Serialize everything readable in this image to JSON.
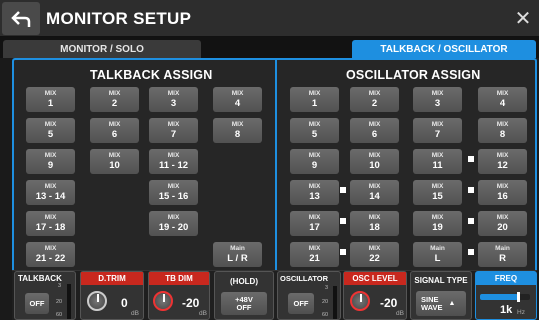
{
  "header": {
    "title": "MONITOR SETUP"
  },
  "tabs": {
    "left": "MONITOR / SOLO",
    "right": "TALKBACK / OSCILLATOR"
  },
  "talkback_assign": {
    "title": "TALKBACK ASSIGN",
    "buttons": [
      {
        "l1": "MIX",
        "l2": "1"
      },
      {
        "l1": "MIX",
        "l2": "2"
      },
      {
        "l1": "MIX",
        "l2": "3"
      },
      {
        "l1": "MIX",
        "l2": "4"
      },
      {
        "l1": "MIX",
        "l2": "5"
      },
      {
        "l1": "MIX",
        "l2": "6"
      },
      {
        "l1": "MIX",
        "l2": "7"
      },
      {
        "l1": "MIX",
        "l2": "8"
      },
      {
        "l1": "MIX",
        "l2": "9"
      },
      {
        "l1": "MIX",
        "l2": "10"
      },
      {
        "l1": "MIX",
        "l2": "11 - 12"
      },
      {
        "l1": "MIX",
        "l2": "13 - 14"
      },
      {
        "l1": "MIX",
        "l2": "15 - 16"
      },
      {
        "l1": "MIX",
        "l2": "17 - 18"
      },
      {
        "l1": "MIX",
        "l2": "19 - 20"
      },
      {
        "l1": "MIX",
        "l2": "21 - 22"
      },
      {
        "l1": "Main",
        "l2": "L / R"
      }
    ]
  },
  "oscillator_assign": {
    "title": "OSCILLATOR  ASSIGN",
    "buttons": [
      {
        "l1": "MIX",
        "l2": "1"
      },
      {
        "l1": "MIX",
        "l2": "2"
      },
      {
        "l1": "MIX",
        "l2": "3"
      },
      {
        "l1": "MIX",
        "l2": "4"
      },
      {
        "l1": "MIX",
        "l2": "5"
      },
      {
        "l1": "MIX",
        "l2": "6"
      },
      {
        "l1": "MIX",
        "l2": "7"
      },
      {
        "l1": "MIX",
        "l2": "8"
      },
      {
        "l1": "MIX",
        "l2": "9"
      },
      {
        "l1": "MIX",
        "l2": "10"
      },
      {
        "l1": "MIX",
        "l2": "11"
      },
      {
        "l1": "MIX",
        "l2": "12"
      },
      {
        "l1": "MIX",
        "l2": "13"
      },
      {
        "l1": "MIX",
        "l2": "14"
      },
      {
        "l1": "MIX",
        "l2": "15"
      },
      {
        "l1": "MIX",
        "l2": "16"
      },
      {
        "l1": "MIX",
        "l2": "17"
      },
      {
        "l1": "MIX",
        "l2": "18"
      },
      {
        "l1": "MIX",
        "l2": "19"
      },
      {
        "l1": "MIX",
        "l2": "20"
      },
      {
        "l1": "MIX",
        "l2": "21"
      },
      {
        "l1": "MIX",
        "l2": "22"
      },
      {
        "l1": "Main",
        "l2": "L"
      },
      {
        "l1": "Main",
        "l2": "R"
      }
    ]
  },
  "bottom": {
    "talkback": {
      "label": "TALKBACK",
      "button": "OFF",
      "meter_top": "3",
      "meter_mid": "20",
      "meter_bot": "60"
    },
    "dtrim": {
      "label": "D.TRIM",
      "value": "0",
      "unit": "dB"
    },
    "tbdim": {
      "label": "TB DIM",
      "value": "-20",
      "unit": "dB"
    },
    "hold": {
      "label": "(HOLD)",
      "line1": "+48V",
      "line2": "OFF"
    },
    "oscillator": {
      "label": "OSCILLATOR",
      "button": "OFF",
      "meter_top": "3",
      "meter_mid": "20",
      "meter_bot": "60"
    },
    "osc_level": {
      "label": "OSC LEVEL",
      "value": "-20",
      "unit": "dB"
    },
    "signal_type": {
      "label": "SIGNAL TYPE",
      "line1": "SINE",
      "line2": "WAVE",
      "arrow": "▲"
    },
    "freq": {
      "label": "FREQ",
      "value": "1k",
      "unit": "Hz",
      "level": 0.75
    }
  },
  "colors": {
    "accent": "#1e8fe0",
    "red": "#c8281e"
  }
}
